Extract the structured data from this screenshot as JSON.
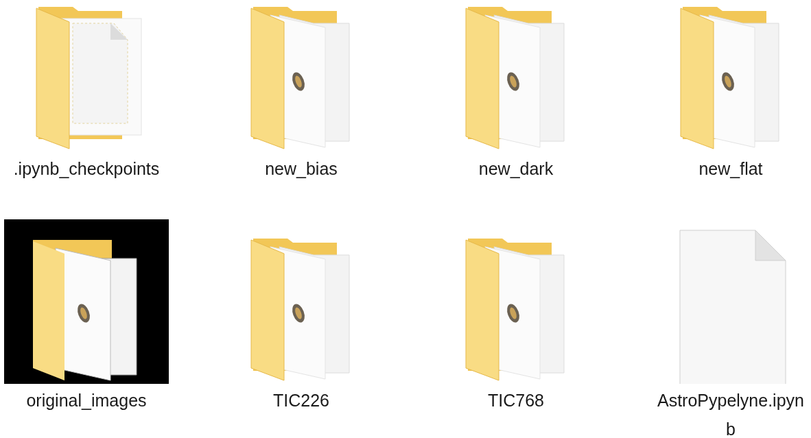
{
  "items": [
    {
      "label": ".ipynb_checkpoints",
      "kind": "folder-doc"
    },
    {
      "label": "new_bias",
      "kind": "folder-images"
    },
    {
      "label": "new_dark",
      "kind": "folder-images"
    },
    {
      "label": "new_flat",
      "kind": "folder-images"
    },
    {
      "label": "original_images",
      "kind": "folder-images-dark"
    },
    {
      "label": "TIC226",
      "kind": "folder-images"
    },
    {
      "label": "TIC768",
      "kind": "folder-images"
    },
    {
      "label": "AstroPypelyne.ipynb",
      "kind": "file"
    }
  ]
}
